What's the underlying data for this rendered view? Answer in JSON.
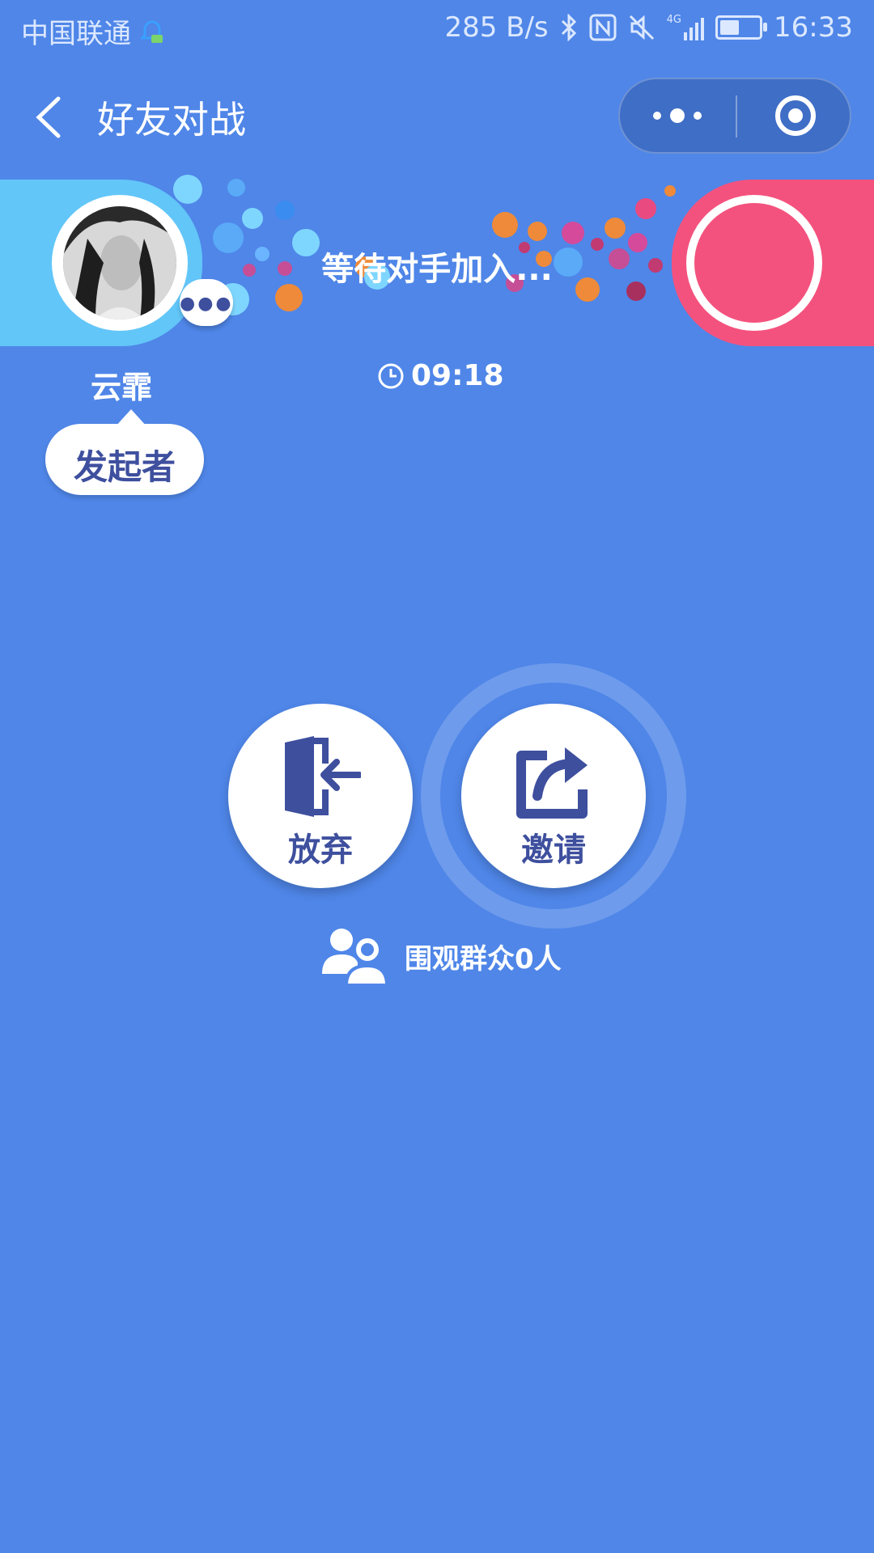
{
  "status_bar": {
    "carrier": "中国联通",
    "speed": "285 B/s",
    "signal_type": "4G",
    "battery_level": 0.5,
    "time": "16:33"
  },
  "nav": {
    "title": "好友对战"
  },
  "match": {
    "waiting_text": "等待对手加入...",
    "player_name": "云霏",
    "player_role": "发起者",
    "timer": "09:18"
  },
  "actions": {
    "quit_label": "放弃",
    "invite_label": "邀请"
  },
  "spectators": {
    "text": "围观群众0人"
  },
  "colors": {
    "background": "#4f86e8",
    "player_banner": "#62c6f8",
    "opponent_banner": "#f4527e",
    "button_text": "#3e4f9e"
  }
}
